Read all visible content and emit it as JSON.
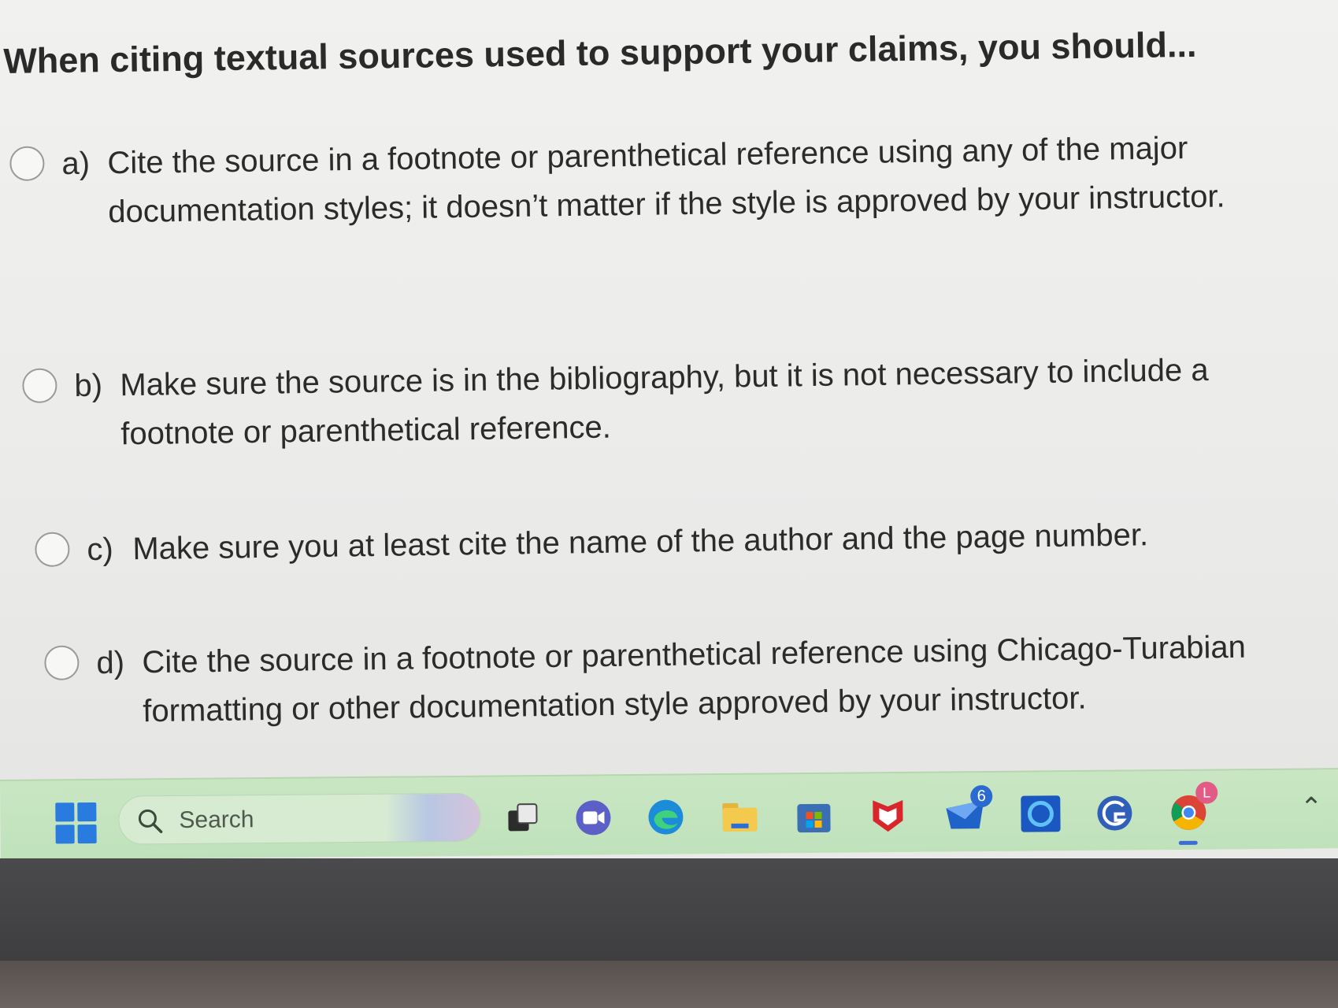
{
  "question": "When citing textual sources used to support your claims, you should...",
  "options": [
    {
      "letter": "a)",
      "text": "Cite the source in a footnote or parenthetical reference using any of the major documentation styles; it doesn’t matter if the style is approved by your instructor.",
      "selected": false
    },
    {
      "letter": "b)",
      "text": "Make sure the source is in the bibliography, but it is not necessary to include a footnote or parenthetical reference.",
      "selected": false
    },
    {
      "letter": "c)",
      "text": "Make sure you at least cite the name of the author and the page number.",
      "selected": false
    },
    {
      "letter": "d)",
      "text": "Cite the source in a footnote or parenthetical reference using Chicago-Turabian formatting or other documentation style approved by your instructor.",
      "selected": false
    }
  ],
  "taskbar": {
    "search_placeholder": "Search",
    "mail_badge": "6",
    "chrome_badge": "L",
    "icons": [
      "windows-start-icon",
      "search-icon",
      "widgets-icon",
      "task-view-icon",
      "teams-chat-icon",
      "edge-icon",
      "file-explorer-icon",
      "microsoft-store-icon",
      "mcafee-icon",
      "mail-icon",
      "cortana-icon",
      "browser-app-icon",
      "chrome-icon",
      "chevron-up-icon"
    ],
    "accent_color": "#c3e4be"
  }
}
